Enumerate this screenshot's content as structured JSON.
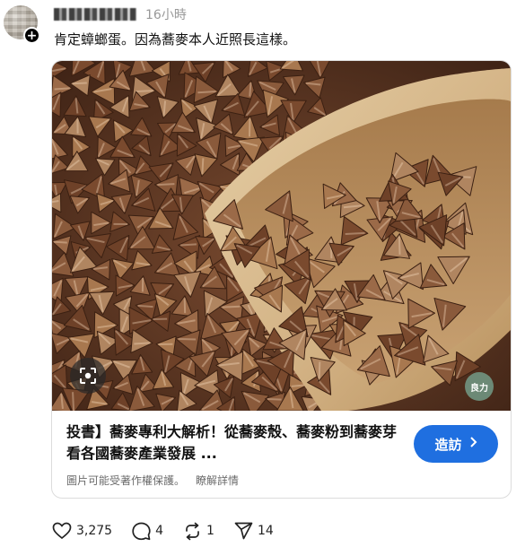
{
  "post": {
    "author_name": "",
    "timestamp": "16小時",
    "text": "肯定蟑螂蛋。因為蕎麥本人近照長這樣。"
  },
  "link_card": {
    "title": "投書】蕎麥專利大解析！從蕎麥殼、蕎麥粉到蕎麥芽看各國蕎麥產業發展 ...",
    "meta_notice": "圖片可能受著作權保護。",
    "meta_details": "瞭解詳情",
    "visit_label": "造訪",
    "watermark_text": "良力"
  },
  "actions": {
    "likes": "3,275",
    "comments": "4",
    "reposts": "1",
    "shares": "14"
  },
  "colors": {
    "accent": "#1f6fe0",
    "muted_text": "#999999"
  },
  "icons": [
    "plus-icon",
    "lens-search-icon",
    "chevron-right-icon",
    "heart-icon",
    "comment-icon",
    "repost-icon",
    "share-icon"
  ]
}
